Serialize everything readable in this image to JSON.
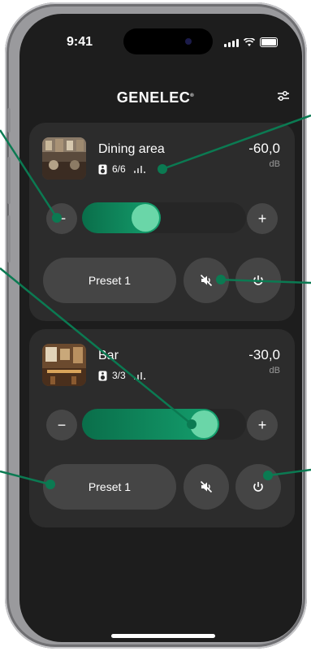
{
  "status": {
    "time": "9:41"
  },
  "header": {
    "brand": "GENELEC",
    "brand_mark": "®",
    "settings_icon": "sliders-icon"
  },
  "zones": [
    {
      "name": "Dining area",
      "speakers": "6/6",
      "level": "-60,0",
      "unit": "dB",
      "volume_fraction": 0.36,
      "preset_label": "Preset 1",
      "minus_label": "−",
      "plus_label": "+"
    },
    {
      "name": "Bar",
      "speakers": "3/3",
      "level": "-30,0",
      "unit": "dB",
      "volume_fraction": 0.8,
      "preset_label": "Preset 1",
      "minus_label": "−",
      "plus_label": "+"
    }
  ],
  "colors": {
    "accent": "#0c8a5d",
    "annotation": "#0b7a52",
    "card": "#2c2c2c",
    "screen": "#1d1d1d"
  }
}
